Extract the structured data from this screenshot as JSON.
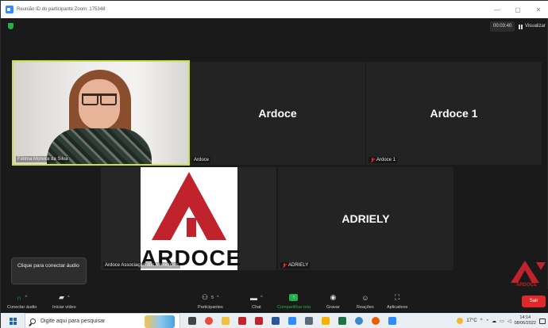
{
  "window": {
    "title": "Reunião ID do participante Zoom: 175348",
    "controls": [
      "—",
      "▢",
      "✕"
    ]
  },
  "top": {
    "timer": "00:03:40",
    "view_label": "Visualizar"
  },
  "tiles": {
    "fatima": {
      "name": "Fátima Moreira da Silva"
    },
    "ardoce": {
      "big_name": "Ardoce",
      "name": "Ardoce"
    },
    "ardoce1": {
      "big_name": "Ardoce 1",
      "name": "Ardoce 1",
      "muted": true
    },
    "assoc": {
      "name": "Ardoce Associação dos Municípios",
      "logo_text": "ARDOCE"
    },
    "adriely": {
      "big_name": "ADRIELY",
      "name": "ADRIELY",
      "muted": true
    }
  },
  "tooltip": "Clique para conectar áudio",
  "watermark": "ARDOCE",
  "toolbar": {
    "connect_audio": "Conectar áudio",
    "start_video": "Iniciar vídeo",
    "participants": "Participantes",
    "participants_count": "5",
    "chat": "Chat",
    "share_screen": "Compartilhar tela",
    "record": "Gravar",
    "reactions": "Reações",
    "apps": "Aplicativos",
    "leave": "Sair"
  },
  "taskbar": {
    "search_placeholder": "Digite aqui para pesquisar",
    "weather": "17°C",
    "time": "14:14",
    "date": "08/06/2022"
  },
  "colors": {
    "active_speaker": "#c4e24a",
    "share_green": "#21b04b",
    "leave_red": "#e02828",
    "brand_red": "#c0232b"
  }
}
